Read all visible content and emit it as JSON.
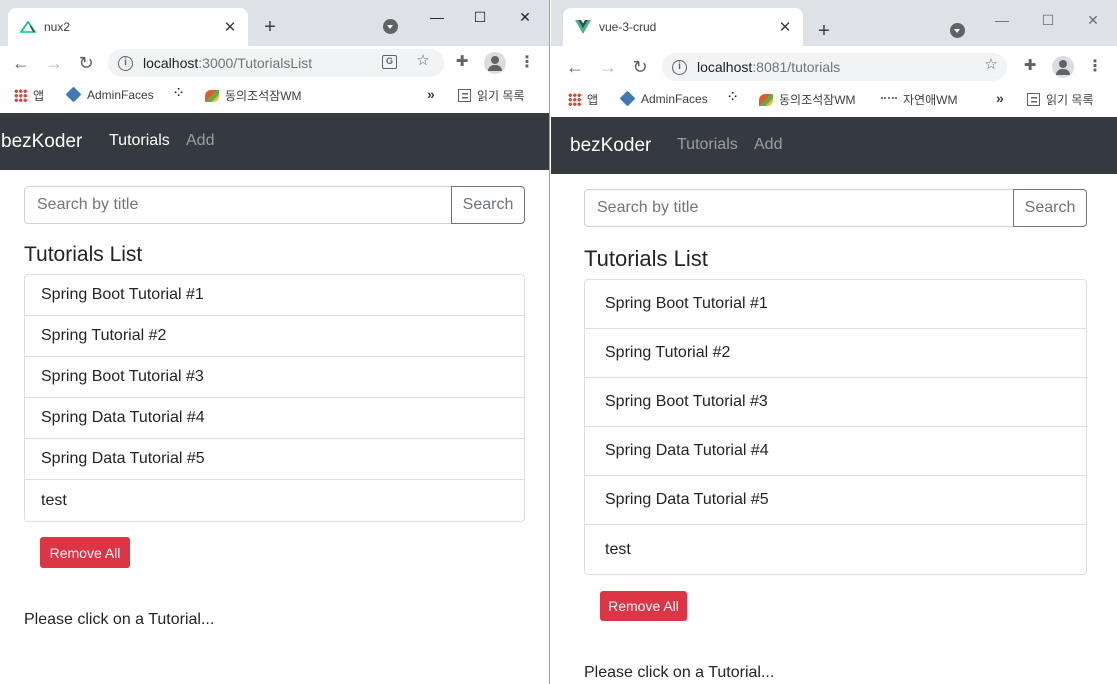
{
  "left_window": {
    "tab_title": "nux2",
    "url_host": "localhost",
    "url_path": ":3000/TutorialsList",
    "bookmarks": [
      "앱",
      "AdminFaces",
      "동의조석잠WM"
    ],
    "reading_list": "읽기 목록",
    "brand": "bezKoder",
    "nav": [
      "Tutorials",
      "Add"
    ],
    "search_placeholder": "Search by title",
    "search_button": "Search",
    "list_title": "Tutorials List",
    "tutorials": [
      "Spring Boot Tutorial #1",
      "Spring Tutorial #2",
      "Spring Boot Tutorial #3",
      "Spring Data Tutorial #4",
      "Spring Data Tutorial #5",
      "test"
    ],
    "remove_all": "Remove All",
    "hint": "Please click on a Tutorial..."
  },
  "right_window": {
    "tab_title": "vue-3-crud",
    "url_host": "localhost",
    "url_path": ":8081/tutorials",
    "bookmarks": [
      "앱",
      "AdminFaces",
      "동의조석잠WM",
      "자연애WM"
    ],
    "reading_list": "읽기 목록",
    "brand": "bezKoder",
    "nav": [
      "Tutorials",
      "Add"
    ],
    "search_placeholder": "Search by title",
    "search_button": "Search",
    "list_title": "Tutorials List",
    "tutorials": [
      "Spring Boot Tutorial #1",
      "Spring Tutorial #2",
      "Spring Boot Tutorial #3",
      "Spring Data Tutorial #4",
      "Spring Data Tutorial #5",
      "test"
    ],
    "remove_all": "Remove All",
    "hint": "Please click on a Tutorial..."
  },
  "colors": {
    "navbar": "#343a40",
    "danger": "#dc3545",
    "nuxt": "#00c58e",
    "vue": "#41b883"
  }
}
